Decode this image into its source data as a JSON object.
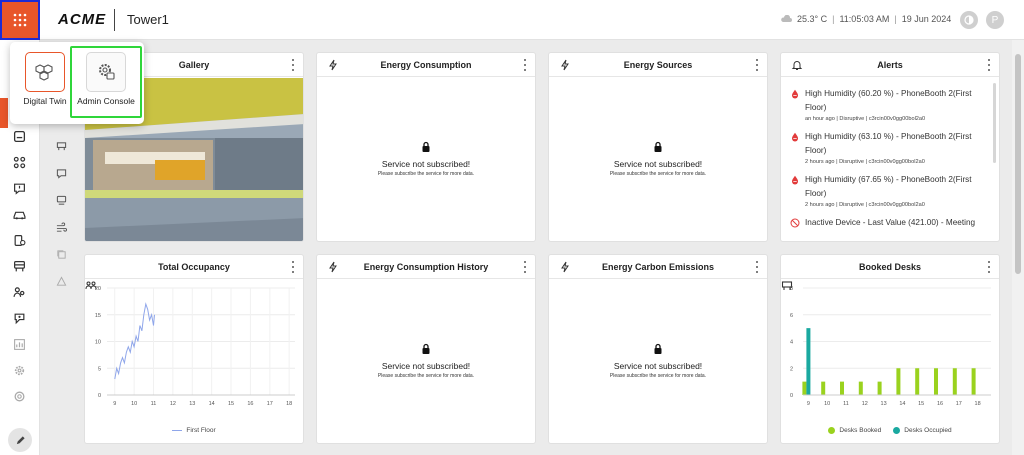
{
  "header": {
    "brand": "ACME",
    "site": "Tower1",
    "temperature": "25.3° C",
    "time": "11:05:03 AM",
    "date": "19 Jun 2024",
    "user_initial": "P"
  },
  "apps_menu": {
    "items": [
      {
        "label": "Digital Twin",
        "icon": "cubes-icon"
      },
      {
        "label": "Admin Console",
        "icon": "gear-settings-icon"
      }
    ]
  },
  "cards": {
    "gallery": {
      "title": "Gallery"
    },
    "energy_consumption": {
      "title": "Energy Consumption",
      "message": "Service not subscribed!",
      "sub": "Please subscribe the service for more data."
    },
    "energy_sources": {
      "title": "Energy Sources",
      "message": "Service not subscribed!",
      "sub": "Please subscribe the service for more data."
    },
    "alerts": {
      "title": "Alerts",
      "items": [
        {
          "text": "High Humidity (60.20 %) - PhoneBooth 2(First Floor)",
          "meta": "an hour ago | Disruptive | c3rcin00v0gg00bol2a0"
        },
        {
          "text": "High Humidity (63.10 %) - PhoneBooth 2(First Floor)",
          "meta": "2 hours ago | Disruptive | c3rcin00v0gg00bol2a0"
        },
        {
          "text": "High Humidity (67.65 %) - PhoneBooth 2(First Floor)",
          "meta": "2 hours ago | Disruptive | c3rcin00v0gg00bol2a0"
        },
        {
          "text": "Inactive Device - Last Value (421.00) - Meeting",
          "meta": ""
        }
      ]
    },
    "total_occupancy": {
      "title": "Total Occupancy"
    },
    "energy_consumption_history": {
      "title": "Energy Consumption History",
      "message": "Service not subscribed!",
      "sub": "Please subscribe the service for more data."
    },
    "energy_carbon_emissions": {
      "title": "Energy Carbon Emissions",
      "message": "Service not subscribed!",
      "sub": "Please subscribe the service for more data."
    },
    "booked_desks": {
      "title": "Booked Desks"
    }
  },
  "chart_data": [
    {
      "type": "line",
      "title": "Total Occupancy",
      "x_ticks": [
        "9",
        "10",
        "11",
        "12",
        "13",
        "14",
        "15",
        "16",
        "17",
        "18"
      ],
      "y_ticks": [
        "0",
        "5",
        "10",
        "15",
        "20"
      ],
      "ylim": [
        0,
        20
      ],
      "xlim": [
        8.6,
        18.3
      ],
      "series": [
        {
          "name": "First Floor",
          "color": "#8fa6ea",
          "points": [
            [
              9.0,
              3
            ],
            [
              9.1,
              5
            ],
            [
              9.2,
              4
            ],
            [
              9.3,
              6
            ],
            [
              9.4,
              7
            ],
            [
              9.5,
              6
            ],
            [
              9.6,
              8
            ],
            [
              9.7,
              9
            ],
            [
              9.8,
              8
            ],
            [
              9.9,
              10
            ],
            [
              10.0,
              9
            ],
            [
              10.1,
              11
            ],
            [
              10.2,
              10
            ],
            [
              10.3,
              13
            ],
            [
              10.4,
              12
            ],
            [
              10.5,
              15
            ],
            [
              10.6,
              17
            ],
            [
              10.7,
              16
            ],
            [
              10.8,
              14
            ],
            [
              10.9,
              15
            ],
            [
              11.0,
              13
            ],
            [
              11.05,
              15
            ]
          ]
        }
      ],
      "grid": true,
      "legend": "bottom"
    },
    {
      "type": "bar",
      "title": "Booked Desks",
      "categories": [
        "9",
        "10",
        "11",
        "12",
        "13",
        "14",
        "15",
        "16",
        "17",
        "18"
      ],
      "y_ticks": [
        "0",
        "2",
        "4",
        "6",
        "8"
      ],
      "ylim": [
        0,
        8
      ],
      "series": [
        {
          "name": "Desks Booked",
          "color": "#9ad21e",
          "values": [
            1,
            1,
            1,
            1,
            1,
            2,
            2,
            2,
            2,
            2
          ]
        },
        {
          "name": "Desks Occupied",
          "color": "#1aa9a0",
          "values": [
            5,
            0,
            0,
            0,
            0,
            0,
            0,
            0,
            0,
            0
          ]
        }
      ],
      "grid": true,
      "legend": "bottom"
    }
  ]
}
